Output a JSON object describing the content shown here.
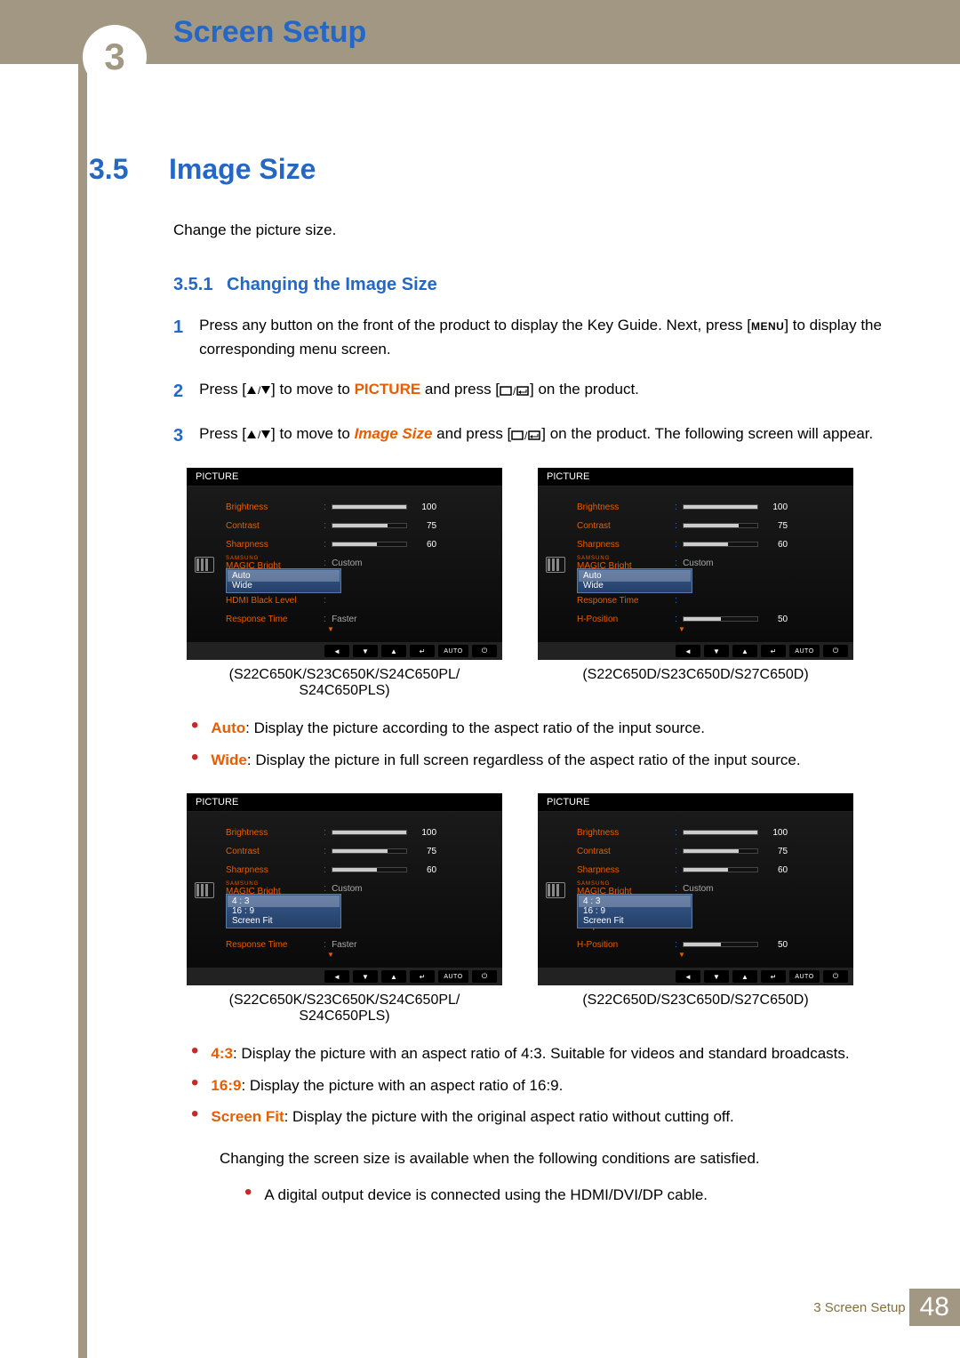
{
  "header": {
    "chapter_num": "3",
    "chapter_title": "Screen Setup"
  },
  "section": {
    "num": "3.5",
    "title": "Image Size",
    "desc": "Change the picture size."
  },
  "subsection": {
    "num": "3.5.1",
    "title": "Changing the Image Size"
  },
  "steps": {
    "s1_a": "Press any button on the front of the product to display the Key Guide. Next, press [",
    "s1_menu": "MENU",
    "s1_b": "] to display the corresponding menu screen.",
    "s2_a": "Press [",
    "s2_b": "] to move to ",
    "s2_picture": "PICTURE",
    "s2_c": " and press [",
    "s2_d": "] on the product.",
    "s3_a": "Press [",
    "s3_b": "] to move to ",
    "s3_imgsize": "Image Size",
    "s3_c": " and press [",
    "s3_d": "] on the product. The following screen will appear."
  },
  "osd_common": {
    "title": "PICTURE",
    "brightness": "Brightness",
    "brightness_val": "100",
    "contrast": "Contrast",
    "contrast_val": "75",
    "sharpness": "Sharpness",
    "sharpness_val": "60",
    "magic_small": "SAMSUNG",
    "magic": "MAGIC Bright",
    "magic_val": "Custom",
    "image_size": "Image Size",
    "hdmi_black": "HDMI Black Level",
    "response": "Response Time",
    "response_val": "Faster",
    "hposition": "H-Position",
    "hposition_val": "50",
    "btn_auto": "AUTO"
  },
  "osd_set1": {
    "dropdown_auto": "Auto",
    "dropdown_wide": "Wide",
    "dropdown_43": "4 : 3",
    "dropdown_169": "16 : 9",
    "dropdown_fit": "Screen Fit"
  },
  "captions": {
    "modelsK": "(S22C650K/S23C650K/S24C650PL/",
    "modelsK2": "S24C650PLS)",
    "modelsD": "(S22C650D/S23C650D/S27C650D)"
  },
  "bullets1": {
    "auto_kw": "Auto",
    "auto_txt": ": Display the picture according to the aspect ratio of the input source.",
    "wide_kw": "Wide",
    "wide_txt": ": Display the picture in full screen regardless of the aspect ratio of the input source."
  },
  "bullets2": {
    "r43_kw": "4:3",
    "r43_txt": ": Display the picture with an aspect ratio of 4:3. Suitable for videos and standard broadcasts.",
    "r169_kw": "16:9",
    "r169_txt": ": Display the picture with an aspect ratio of 16:9.",
    "fit_kw": "Screen Fit",
    "fit_txt": ": Display the picture with the original aspect ratio without cutting off.",
    "cond": "Changing the screen size is available when the following conditions are satisfied.",
    "cond1": "A digital output device is connected using the HDMI/DVI/DP cable."
  },
  "footer": {
    "text": "3 Screen Setup",
    "page": "48"
  }
}
